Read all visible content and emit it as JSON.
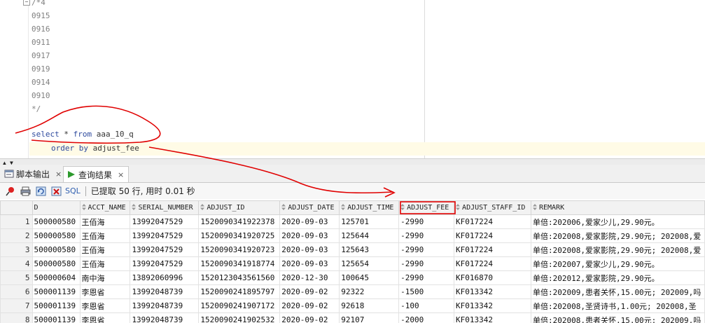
{
  "editor": {
    "comment_lines": [
      "/*4",
      "0915",
      "0916",
      "0911",
      "0917",
      "0919",
      "0914",
      "0910",
      "*/"
    ],
    "sql_line1": {
      "kw1": "select",
      "rest": " * ",
      "kw2": "from",
      "table": " aaa_10_q"
    },
    "sql_line2": {
      "kw": "order by",
      "col": " adjust_fee"
    },
    "fold_symbol": "−"
  },
  "tabs": [
    {
      "label": "脚本输出",
      "icon": "script-output-icon",
      "close": "×"
    },
    {
      "label": "查询结果",
      "icon": "query-result-icon",
      "close": "×"
    }
  ],
  "toolbar": {
    "sql_label": "SQL",
    "status": "已提取 50 行, 用时 0.01 秒",
    "icons": [
      "pin-icon",
      "print-icon",
      "refresh-icon",
      "cancel-query-icon"
    ]
  },
  "grid": {
    "columns": [
      "D",
      "ACCT_NAME",
      "SERIAL_NUMBER",
      "ADJUST_ID",
      "ADJUST_DATE",
      "ADJUST_TIME",
      "ADJUST_FEE",
      "ADJUST_STAFF_ID",
      "REMARK"
    ],
    "rows": [
      {
        "n": "1",
        "cells": [
          "500000580",
          "王佰海",
          "13992047529",
          "1520090341922378",
          "2020-09-03",
          "125701",
          "-2990",
          "KF017224",
          "单倍:202006,爱家少儿,29.90元。"
        ]
      },
      {
        "n": "2",
        "cells": [
          "500000580",
          "王佰海",
          "13992047529",
          "1520090341920725",
          "2020-09-03",
          "125644",
          "-2990",
          "KF017224",
          "单倍:202008,爱家影院,29.90元; 202008,爱"
        ]
      },
      {
        "n": "3",
        "cells": [
          "500000580",
          "王佰海",
          "13992047529",
          "1520090341920723",
          "2020-09-03",
          "125643",
          "-2990",
          "KF017224",
          "单倍:202008,爱家影院,29.90元; 202008,爱"
        ]
      },
      {
        "n": "4",
        "cells": [
          "500000580",
          "王佰海",
          "13992047529",
          "1520090341918774",
          "2020-09-03",
          "125654",
          "-2990",
          "KF017224",
          "单倍:202007,爱家少儿,29.90元。"
        ]
      },
      {
        "n": "5",
        "cells": [
          "500000604",
          "南中海",
          "13892060996",
          "1520123043561560",
          "2020-12-30",
          "100645",
          "-2990",
          "KF016870",
          "单倍:202012,爱家影院,29.90元。"
        ]
      },
      {
        "n": "6",
        "cells": [
          "500001139",
          "李恩省",
          "13992048739",
          "1520090241895797",
          "2020-09-02",
          "92322",
          "-1500",
          "KF013342",
          "单倍:202009,患者关怀,15.00元; 202009,吗"
        ]
      },
      {
        "n": "7",
        "cells": [
          "500001139",
          "李恩省",
          "13992048739",
          "1520090241907172",
          "2020-09-02",
          "92618",
          "-100",
          "KF013342",
          "单倍:202008,圣贤诗书,1.00元; 202008,圣"
        ]
      },
      {
        "n": "8",
        "cells": [
          "500001139",
          "李恩省",
          "13992048739",
          "1520090241902532",
          "2020-09-02",
          "92107",
          "-2000",
          "KF013342",
          "单倍:202008,患者关怀,15.00元; 202009,吗"
        ]
      }
    ]
  },
  "colors": {
    "annotation_red": "#e00000",
    "keyword_blue": "#2e4a9e",
    "sql_blue": "#2f5fb0"
  }
}
